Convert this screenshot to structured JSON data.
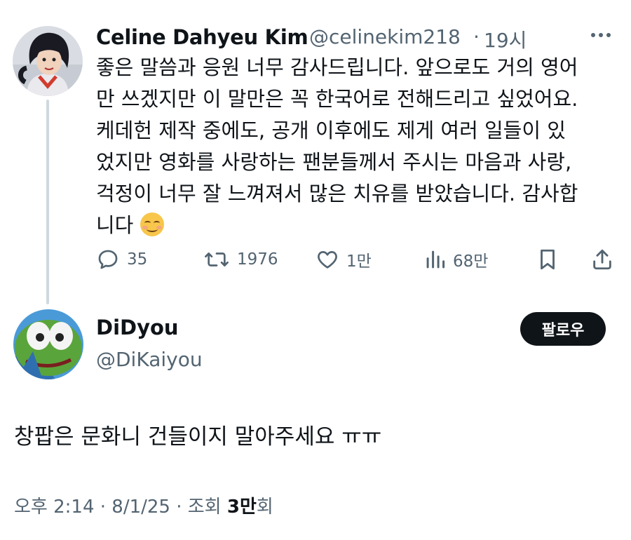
{
  "original_tweet": {
    "display_name": "Celine Dahyeu Kim",
    "handle": "@celinekim218",
    "separator": "·",
    "time": "19시",
    "body_lines": [
      "좋은 말씀과 응원 너무 감사드립니다. 앞으로도 거의 영어",
      "만 쓰겠지만 이 말만은 꼭 한국어로 전해드리고 싶었어요.",
      "케데헌 제작 중에도, 공개 이후에도 제게 여러 일들이 있",
      "었지만 영화를 사랑하는 팬분들께서 주시는 마음과 사랑,",
      "걱정이 너무 잘 느껴져서 많은 치유를 받았습니다. 감사합",
      "니다"
    ],
    "emoji": "smiling-face-emoji",
    "actions": {
      "replies": "35",
      "retweets": "1976",
      "likes": "1만",
      "views": "68만"
    }
  },
  "reply_tweet": {
    "display_name": "DiDyou",
    "handle": "@DiKaiyou",
    "follow_label": "팔로우",
    "body": "창팝은 문화니 건들이지 말아주세요 ㅠㅠ",
    "meta_prefix": "오후 2:14 · 8/1/25 · 조회 ",
    "views_count": "3만",
    "views_suffix": "회"
  },
  "colors": {
    "text": "#0f1419",
    "secondary": "#536471",
    "thread_line": "#cfd9de",
    "button_bg": "#0f1419"
  }
}
